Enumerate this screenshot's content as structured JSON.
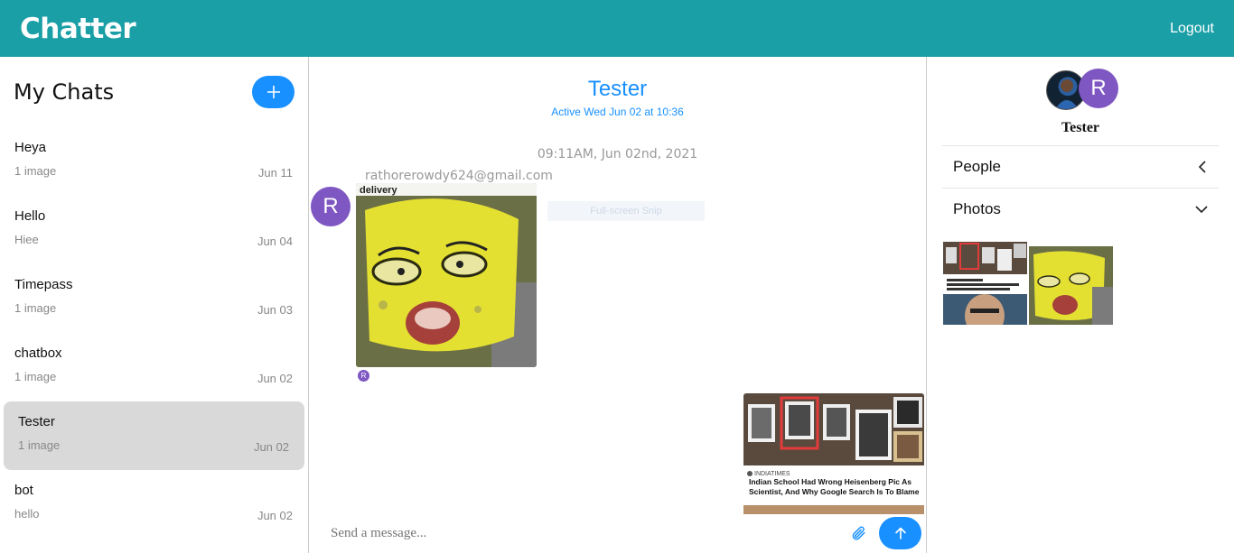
{
  "header": {
    "brand": "Chatter",
    "logout_label": "Logout"
  },
  "sidebar": {
    "title": "My Chats",
    "add_icon": "plus-icon",
    "chats": [
      {
        "name": "Heya",
        "preview": "1 image",
        "date": "Jun 11"
      },
      {
        "name": "Hello",
        "preview": "Hiee",
        "date": "Jun 04"
      },
      {
        "name": "Timepass",
        "preview": "1 image",
        "date": "Jun 03"
      },
      {
        "name": "chatbox",
        "preview": "1 image",
        "date": "Jun 02"
      },
      {
        "name": "Tester",
        "preview": "1 image",
        "date": "Jun 02",
        "active": true
      },
      {
        "name": "bot",
        "preview": "hello",
        "date": "Jun 02"
      }
    ]
  },
  "conversation": {
    "title": "Tester",
    "active_text": "Active Wed Jun 02 at 10:36",
    "timestamp": "09:11AM, Jun 02nd, 2021",
    "sender_email": "rathorerowdy624@gmail.com",
    "avatar_letter": "R",
    "snip_label": "Full-screen Snip",
    "sponge_caption": "delivery",
    "news": {
      "source": "INDIATIMES",
      "headline": "Indian School Had Wrong Heisenberg Pic As Scientist, And Why Google Search Is To Blame"
    }
  },
  "composer": {
    "placeholder": "Send a message...",
    "attach_icon": "paperclip-icon",
    "send_icon": "arrow-up-icon"
  },
  "details": {
    "avatar_letter": "R",
    "name": "Tester",
    "sections": [
      {
        "label": "People",
        "icon": "chevron-left-icon"
      },
      {
        "label": "Photos",
        "icon": "chevron-down-icon"
      }
    ]
  },
  "colors": {
    "header": "#1a9fa6",
    "accent": "#1890ff",
    "avatar": "#7e57c2"
  }
}
